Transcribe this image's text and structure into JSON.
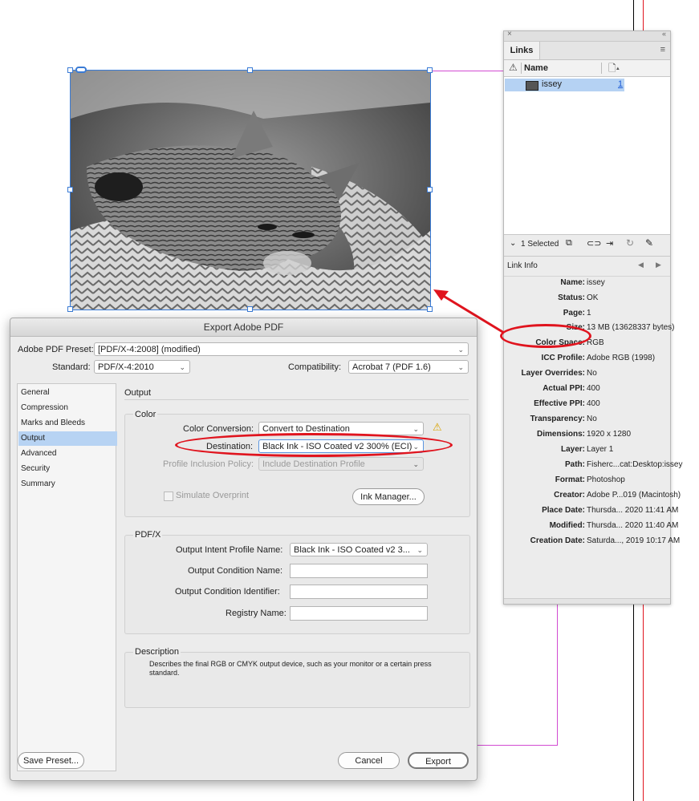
{
  "links_panel": {
    "tab": "Links",
    "column_name": "Name",
    "link_item": {
      "name": "issey",
      "page": "1"
    },
    "selected_count": "1 Selected",
    "link_info_title": "Link Info",
    "info": [
      {
        "label": "Name:",
        "value": "issey"
      },
      {
        "label": "Status:",
        "value": "OK"
      },
      {
        "label": "Page:",
        "value": "1"
      },
      {
        "label": "Size:",
        "value": "13 MB (13628337 bytes)"
      },
      {
        "label": "Color Space:",
        "value": "RGB"
      },
      {
        "label": "ICC Profile:",
        "value": "Adobe RGB (1998)"
      },
      {
        "label": "Layer Overrides:",
        "value": "No"
      },
      {
        "label": "Actual PPI:",
        "value": "400"
      },
      {
        "label": "Effective PPI:",
        "value": "400"
      },
      {
        "label": "Transparency:",
        "value": "No"
      },
      {
        "label": "Dimensions:",
        "value": "1920 x 1280"
      },
      {
        "label": "Layer:",
        "value": "Layer 1"
      },
      {
        "label": "Path:",
        "value": "Fisherc...cat:Desktop:issey"
      },
      {
        "label": "Format:",
        "value": "Photoshop"
      },
      {
        "label": "Creator:",
        "value": "Adobe P...019 (Macintosh)"
      },
      {
        "label": "Place Date:",
        "value": "Thursda... 2020 11:41 AM"
      },
      {
        "label": "Modified:",
        "value": "Thursda... 2020 11:40 AM"
      },
      {
        "label": "Creation Date:",
        "value": "Saturda..., 2019 10:17 AM"
      }
    ]
  },
  "dialog": {
    "title": "Export Adobe PDF",
    "preset_label": "Adobe PDF Preset:",
    "preset_value": "[PDF/X-4:2008] (modified)",
    "standard_label": "Standard:",
    "standard_value": "PDF/X-4:2010",
    "compat_label": "Compatibility:",
    "compat_value": "Acrobat 7 (PDF 1.6)",
    "nav": [
      "General",
      "Compression",
      "Marks and Bleeds",
      "Output",
      "Advanced",
      "Security",
      "Summary"
    ],
    "section_title": "Output",
    "color_group": "Color",
    "color_conversion_label": "Color Conversion:",
    "color_conversion_value": "Convert to Destination",
    "destination_label": "Destination:",
    "destination_value": "Black Ink - ISO Coated v2 300% (ECI)",
    "profile_policy_label": "Profile Inclusion Policy:",
    "profile_policy_value": "Include Destination Profile",
    "simulate_overprint": "Simulate Overprint",
    "ink_manager": "Ink Manager...",
    "pdfx_group": "PDF/X",
    "output_intent_label": "Output Intent Profile Name:",
    "output_intent_value": "Black Ink - ISO Coated v2 3...",
    "condition_name_label": "Output Condition Name:",
    "condition_id_label": "Output Condition Identifier:",
    "registry_label": "Registry Name:",
    "description_group": "Description",
    "description_text": "Describes the final RGB or CMYK output device, such as your monitor or a certain press standard.",
    "save_preset": "Save Preset...",
    "cancel": "Cancel",
    "export": "Export"
  },
  "colors": {
    "annotation": "#e0141e",
    "selection": "#b5d2f3",
    "frame": "#3a7bd5",
    "guide": "#d24bd2"
  }
}
